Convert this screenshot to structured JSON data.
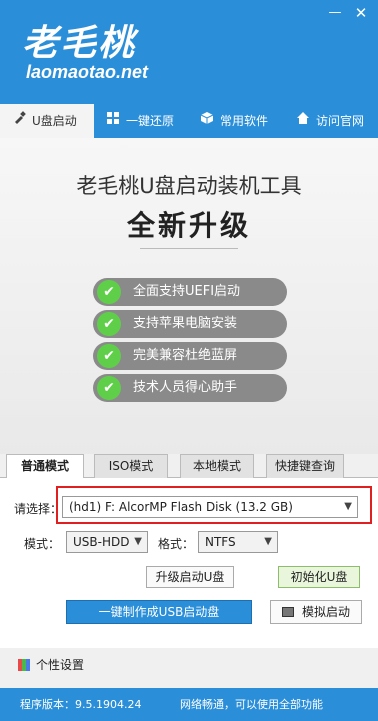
{
  "window": {
    "logo_cn": "老毛桃",
    "logo_en": "laomaotao.net",
    "min_glyph": "—",
    "close_glyph": "✕"
  },
  "topnav": {
    "items": [
      {
        "label": "U盘启动",
        "icon": "usb-icon",
        "active": true
      },
      {
        "label": "一键还原",
        "icon": "windows-icon",
        "active": false
      },
      {
        "label": "常用软件",
        "icon": "box-icon",
        "active": false
      },
      {
        "label": "访问官网",
        "icon": "home-icon",
        "active": false
      }
    ]
  },
  "banner": {
    "title": "老毛桃U盘启动装机工具",
    "subtitle": "全新升级",
    "features": [
      "全面支持UEFI启动",
      "支持苹果电脑安装",
      "完美兼容杜绝蓝屏",
      "技术人员得心助手"
    ],
    "check_glyph": "✔"
  },
  "mode_tabs": [
    {
      "label": "普通模式",
      "active": true
    },
    {
      "label": "ISO模式",
      "active": false
    },
    {
      "label": "本地模式",
      "active": false
    },
    {
      "label": "快捷键查询",
      "active": false
    }
  ],
  "form": {
    "select_label": "请选择：",
    "device_value": "(hd1) F: AlcorMP Flash Disk (13.2 GB)",
    "mode_label": "模式：",
    "mode_value": "USB-HDD",
    "format_label": "格式：",
    "format_value": "NTFS"
  },
  "buttons": {
    "upgrade": "升级启动U盘",
    "init": "初始化U盘",
    "make": "一键制作成USB启动盘",
    "simulate": "模拟启动"
  },
  "personal": "个性设置",
  "status": {
    "version": "程序版本：9.5.1904.24",
    "network": "网络畅通，可以使用全部功能"
  },
  "colors": {
    "brand_blue": "#2a8ed8",
    "check_green": "#5fcf4a",
    "highlight_red": "#e02020"
  }
}
